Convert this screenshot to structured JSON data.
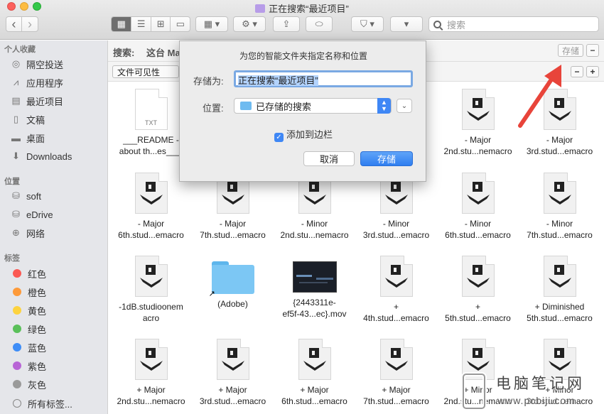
{
  "window": {
    "title": "正在搜索“最近项目”"
  },
  "toolbar": {
    "back": "‹",
    "forward": "›",
    "search_placeholder": "搜索"
  },
  "scope": {
    "search_label": "搜索:",
    "scope_value": "这台 Ma",
    "save_label": "存储",
    "minus_label": "−"
  },
  "filter": {
    "criteria": "文件可见性",
    "minus_label": "−",
    "plus_label": "+"
  },
  "sidebar": {
    "favorites_header": "个人收藏",
    "favorites": [
      "隔空投送",
      "应用程序",
      "最近项目",
      "文稿",
      "桌面",
      "Downloads"
    ],
    "locations_header": "位置",
    "locations": [
      "soft",
      "eDrive",
      "网络"
    ],
    "tags_header": "标签",
    "tags": [
      {
        "name": "红色",
        "color": "#fb5953"
      },
      {
        "name": "橙色",
        "color": "#fd9a3a"
      },
      {
        "name": "黄色",
        "color": "#fdd33f"
      },
      {
        "name": "绿色",
        "color": "#5ac05a"
      },
      {
        "name": "蓝色",
        "color": "#3e8df7"
      },
      {
        "name": "紫色",
        "color": "#b865d6"
      },
      {
        "name": "灰色",
        "color": "#9a9a9a"
      }
    ],
    "all_tags": "所有标签..."
  },
  "dialog": {
    "prompt": "为您的智能文件夹指定名称和位置",
    "save_as_label": "存储为:",
    "name_value": "正在搜索“最近项目”",
    "location_label": "位置:",
    "location_value": "已存储的搜索",
    "sidebar_checkbox": "添加到边栏",
    "cancel": "取消",
    "save": "存储"
  },
  "files": [
    {
      "line1": "___README -",
      "line2": "about th...es___.",
      "kind": "txt",
      "badge": "TXT"
    },
    {
      "line1": "",
      "line2": "",
      "kind": "hidden"
    },
    {
      "line1": "",
      "line2": "",
      "kind": "hidden"
    },
    {
      "line1": "",
      "line2": "",
      "kind": "hidden"
    },
    {
      "line1": "- Major",
      "line2": "2nd.stu...nemacro",
      "kind": "macro"
    },
    {
      "line1": "- Major",
      "line2": "3rd.stud...emacro",
      "kind": "macro"
    },
    {
      "line1": "- Major",
      "line2": "6th.stud...emacro",
      "kind": "macro"
    },
    {
      "line1": "- Major",
      "line2": "7th.stud...emacro",
      "kind": "macro"
    },
    {
      "line1": "- Minor",
      "line2": "2nd.stu...nemacro",
      "kind": "macro"
    },
    {
      "line1": "- Minor",
      "line2": "3rd.stud...emacro",
      "kind": "macro"
    },
    {
      "line1": "- Minor",
      "line2": "6th.stud...emacro",
      "kind": "macro"
    },
    {
      "line1": "- Minor",
      "line2": "7th.stud...emacro",
      "kind": "macro"
    },
    {
      "line1": "-1dB.studioonem",
      "line2": "acro",
      "kind": "macro"
    },
    {
      "line1": "(Adobe)",
      "line2": "",
      "kind": "folder"
    },
    {
      "line1": "{2443311e-",
      "line2": "ef5f-43...ec}.mov",
      "kind": "movie"
    },
    {
      "line1": "+",
      "line2": "4th.stud...emacro",
      "kind": "macro"
    },
    {
      "line1": "+",
      "line2": "5th.stud...emacro",
      "kind": "macro"
    },
    {
      "line1": "+ Diminished",
      "line2": "5th.stud...emacro",
      "kind": "macro"
    },
    {
      "line1": "+ Major",
      "line2": "2nd.stu...nemacro",
      "kind": "macro"
    },
    {
      "line1": "+ Major",
      "line2": "3rd.stud...emacro",
      "kind": "macro"
    },
    {
      "line1": "+ Major",
      "line2": "6th.stud...emacro",
      "kind": "macro"
    },
    {
      "line1": "+ Major",
      "line2": "7th.stud...emacro",
      "kind": "macro"
    },
    {
      "line1": "+ Minor",
      "line2": "2nd.stu...nemacro",
      "kind": "macro"
    },
    {
      "line1": "+ Minor",
      "line2": "3rd.stud...emacro",
      "kind": "macro"
    }
  ],
  "watermark": {
    "cn": "电脑笔记网",
    "url": "www.pcbiji.com"
  }
}
